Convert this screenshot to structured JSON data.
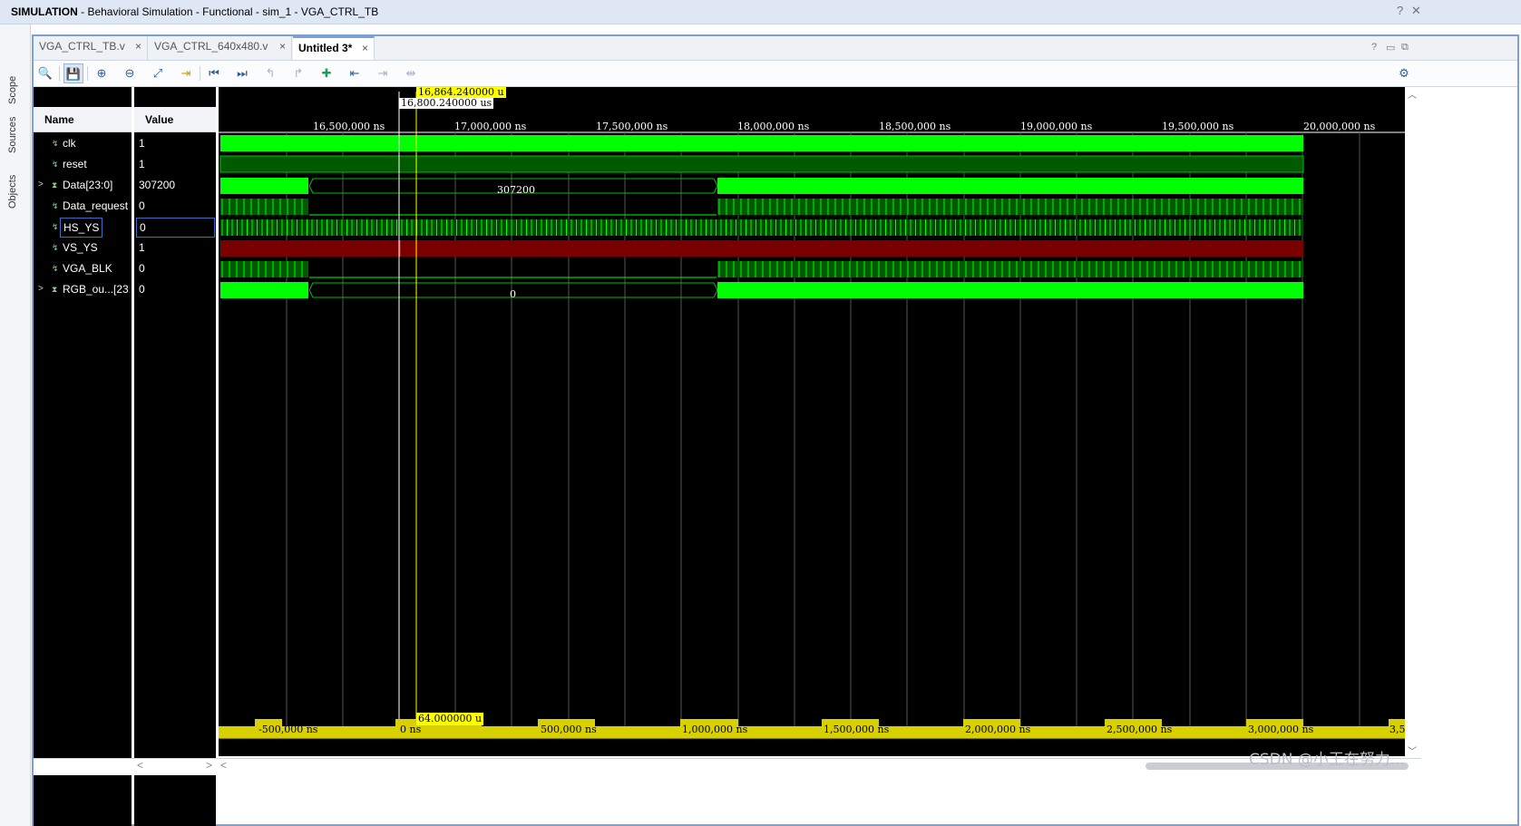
{
  "titlebar": {
    "mode": "SIMULATION",
    "title": " - Behavioral Simulation - Functional - sim_1 - VGA_CTRL_TB",
    "help": "?",
    "close": "✕"
  },
  "side_tabs": [
    "Scope",
    "Sources",
    "Objects"
  ],
  "tabs": [
    {
      "label": "VGA_CTRL_TB.v",
      "active": false
    },
    {
      "label": "VGA_CTRL_640x480.v",
      "active": false
    },
    {
      "label": "Untitled 3*",
      "active": true
    }
  ],
  "tab_close": "×",
  "window_controls": [
    "?",
    "▭",
    "⧉"
  ],
  "toolbar": {
    "tools": [
      {
        "icon": "search-icon",
        "glyph": "🔍"
      },
      {
        "icon": "save-icon",
        "glyph": "💾"
      },
      {
        "icon": "zoom-in-icon",
        "glyph": "⊕"
      },
      {
        "icon": "zoom-out-icon",
        "glyph": "⊖"
      },
      {
        "icon": "zoom-fit-icon",
        "glyph": "⤢"
      },
      {
        "icon": "go-to-cursor-icon",
        "glyph": "⇥"
      },
      {
        "icon": "go-to-time-zero-icon",
        "glyph": "⏮"
      },
      {
        "icon": "go-to-last-time-icon",
        "glyph": "⏭"
      },
      {
        "icon": "previous-transition-icon",
        "glyph": "↰"
      },
      {
        "icon": "next-transition-icon",
        "glyph": "↱"
      },
      {
        "icon": "add-marker-icon",
        "glyph": "✚"
      },
      {
        "icon": "previous-marker-icon",
        "glyph": "⇤"
      },
      {
        "icon": "next-marker-icon",
        "glyph": "⇥"
      },
      {
        "icon": "swap-cursors-icon",
        "glyph": "⇹"
      }
    ],
    "settings_glyph": "⚙"
  },
  "columns": {
    "name": "Name",
    "value": "Value"
  },
  "signals": [
    {
      "name": "clk",
      "value": "1",
      "bus": false
    },
    {
      "name": "reset",
      "value": "1",
      "bus": false
    },
    {
      "name": "Data[23:0]",
      "value": "307200",
      "bus": true
    },
    {
      "name": "Data_request",
      "value": "0",
      "bus": false
    },
    {
      "name": "HS_YS",
      "value": "0",
      "bus": false,
      "selected": true
    },
    {
      "name": "VS_YS",
      "value": "1",
      "bus": false
    },
    {
      "name": "VGA_BLK",
      "value": "0",
      "bus": false
    },
    {
      "name": "RGB_ou...[23:0]",
      "value": "0",
      "bus": true
    }
  ],
  "waveform": {
    "cursor_main": "16,864.240000 u",
    "cursor_secondary": "16,800.240000 us",
    "delta": "64.000000 u",
    "bus_labels": {
      "data": "307200",
      "rgb": "0"
    },
    "top_ticks": [
      "16,500,000 ns",
      "17,000,000 ns",
      "17,500,000 ns",
      "18,000,000 ns",
      "18,500,000 ns",
      "19,000,000 ns",
      "19,500,000 ns",
      "20,000,000 ns"
    ],
    "bottom_ticks": [
      "-500,000 ns",
      "0 ns",
      "500,000 ns",
      "1,000,000 ns",
      "1,500,000 ns",
      "2,000,000 ns",
      "2,500,000 ns",
      "3,000,000 ns",
      "3,5"
    ],
    "colors": {
      "signal": "#00ff00",
      "dark_signal": "#005a00",
      "x_state": "#7a0000",
      "marker": "#ffff00",
      "background": "#000000"
    }
  },
  "watermark": "CSDN @小王在努力..."
}
